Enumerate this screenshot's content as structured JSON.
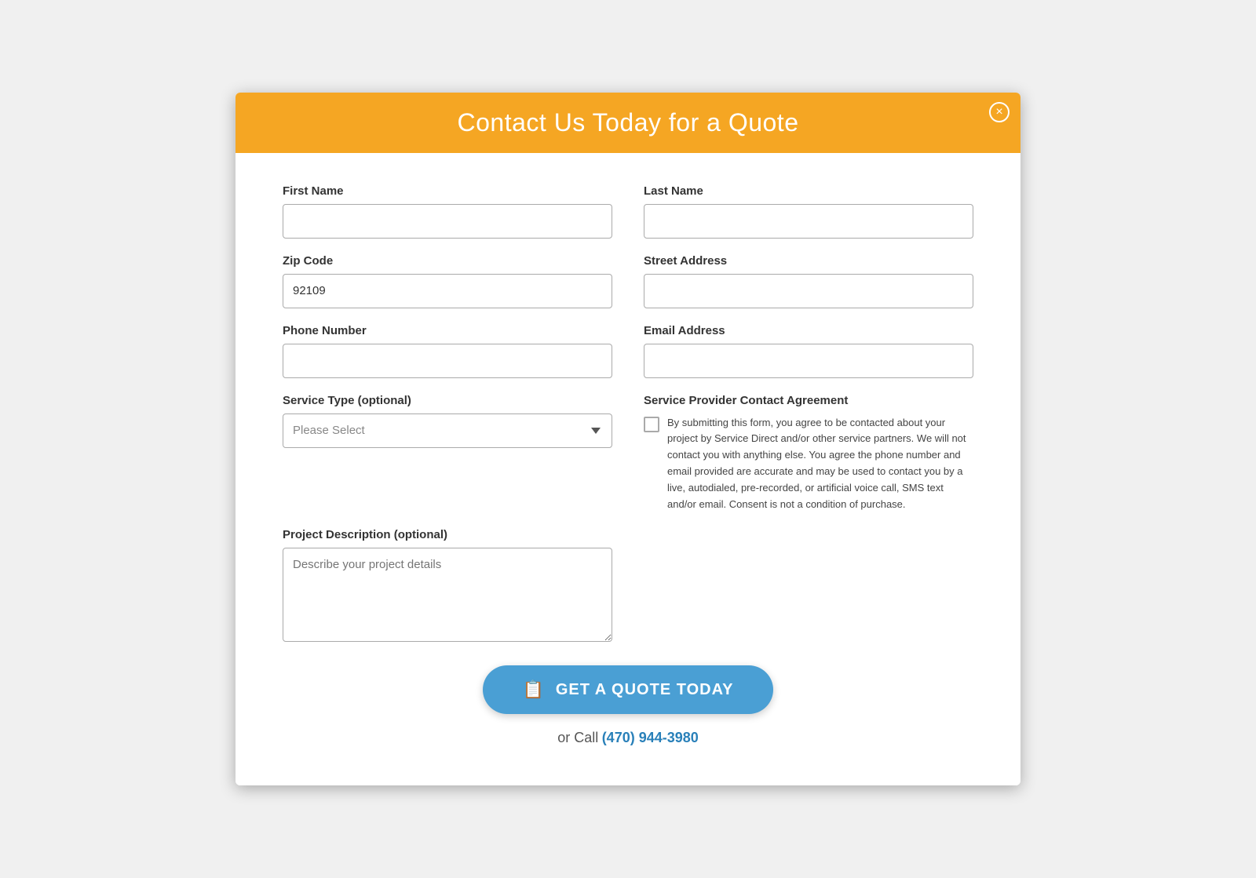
{
  "modal": {
    "title": "Contact Us Today for a Quote",
    "close_label": "×"
  },
  "form": {
    "first_name_label": "First Name",
    "first_name_value": "",
    "first_name_placeholder": "",
    "last_name_label": "Last Name",
    "last_name_value": "",
    "last_name_placeholder": "",
    "zip_code_label": "Zip Code",
    "zip_code_value": "92109",
    "street_address_label": "Street Address",
    "street_address_value": "",
    "phone_number_label": "Phone Number",
    "phone_number_value": "",
    "email_address_label": "Email Address",
    "email_address_value": "",
    "service_type_label": "Service Type (optional)",
    "service_type_placeholder": "Please Select",
    "agreement_title": "Service Provider Contact Agreement",
    "agreement_text": "By submitting this form, you agree to be contacted about your project by Service Direct and/or other service partners. We will not contact you with anything else. You agree the phone number and email provided are accurate and may be used to contact you by a live, autodialed, pre-recorded, or artificial voice call, SMS text and/or email. Consent is not a condition of purchase.",
    "project_description_label": "Project Description (optional)",
    "project_description_placeholder": "Describe your project details",
    "submit_label": "GET A QUOTE TODAY",
    "call_text": "or Call",
    "call_number": "(470) 944-3980"
  }
}
